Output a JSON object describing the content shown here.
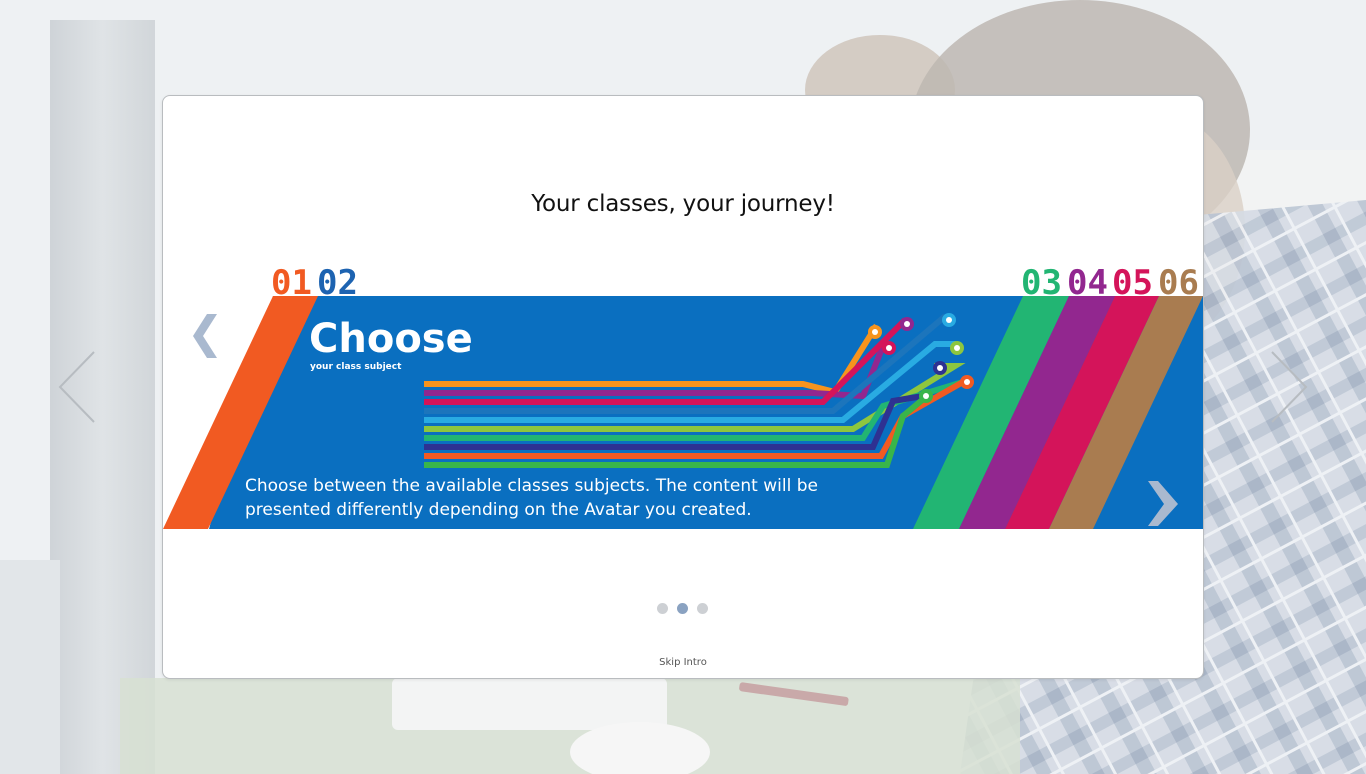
{
  "page": {
    "heading": "Your classes, your journey!",
    "skip_label": "Skip Intro"
  },
  "slide": {
    "numbers": [
      "01",
      "02",
      "03",
      "04",
      "05",
      "06"
    ],
    "title": "Choose",
    "subtitle": "your class subject",
    "description_lines": [
      "Choose between the available classes subjects. The content will be",
      "presented differently depending on the Avatar you created."
    ]
  },
  "pagination": {
    "count": 3,
    "active_index": 1
  },
  "colors": {
    "banner_blue": "#0a6fc0",
    "orange": "#f15a22",
    "navy": "#1d63b1",
    "green": "#22b573",
    "purple": "#92278f",
    "magenta": "#d4145a",
    "brown": "#a97c50",
    "arrow_grey": "#a9b9cf"
  },
  "icons": {
    "outer_prev": "chevron-left-thin-icon",
    "outer_next": "chevron-right-thin-icon",
    "slide_prev": "chevron-left-bold-icon",
    "slide_next": "chevron-right-bold-icon"
  }
}
